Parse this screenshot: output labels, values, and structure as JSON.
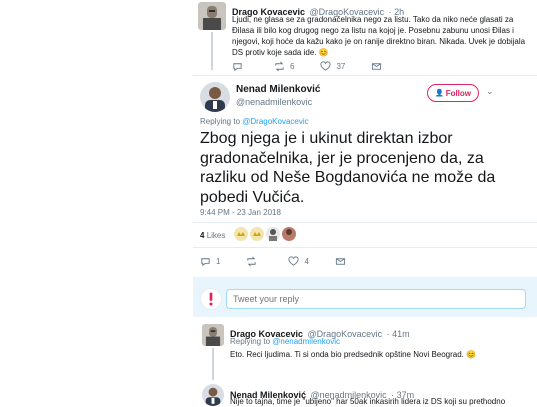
{
  "tweet1": {
    "name": "Drago Kovacevic",
    "handle": "@DragoKovacevic",
    "time": "· 2h",
    "text": "Ljudi, ne glasa se za gradonačelnika nego za listu. Tako da niko neće glasati za Đilasa ili bilo kog drugog nego za listu na kojoj je. Posebnu zabunu unosi Đilas i njegovi, koji hoće da kažu kako je on ranije direktno biran. Nikada. Uvek je dobijala DS protiv koje sada ide. 😊",
    "replies": "",
    "retweets": "6",
    "likes": "37"
  },
  "main": {
    "name": "Nenad Milenković",
    "handle": "@nenadmilenkovic",
    "follow_label": "Follow",
    "replying_prefix": "Replying to",
    "replying_to": "@DragoKovacevic",
    "text_lines": [
      "Zbog njega je i ukinut direktan izbor",
      "gradonačelnika, jer je procenjeno da, za",
      "razliku od Neše Bogdanovića ne može da",
      "pobedi Vučića."
    ],
    "timestamp": "9:44 PM - 23 Jan 2018",
    "likes_count": "4",
    "likes_label": "Likes",
    "reply_count": "1",
    "retweet_count": "",
    "like_count": "4"
  },
  "composer": {
    "placeholder": "Tweet your reply"
  },
  "tweet3": {
    "name": "Drago Kovacevic",
    "handle": "@DragoKovacevic",
    "time": "· 41m",
    "replying_prefix": "Replying to",
    "replying_to": "@nenadmilenkovic",
    "text": "Eto. Reci ljudima. Ti si onda bio predsednik opštine Novi Beograd. 😊"
  },
  "tweet4": {
    "name": "Nenad Milenković",
    "handle": "@nenadmilenkovic",
    "time": "· 37m",
    "text": "Nije to tajna, time je \"ubijeno\" har 50ak inkasirih lidera iz DS koji su prethodno"
  },
  "colors": {
    "accent": "#1da1f2",
    "follow_red": "#e0245e",
    "text": "#14171a",
    "muted": "#657786"
  }
}
